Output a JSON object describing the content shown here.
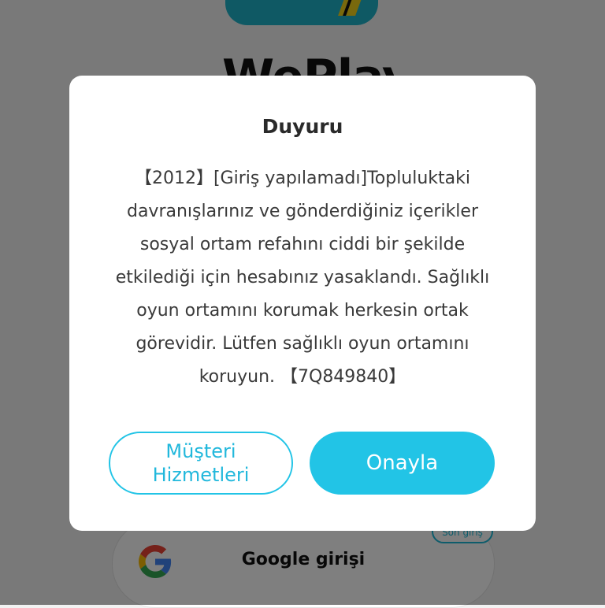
{
  "background": {
    "app_name": "WePlay",
    "google_login_label": "Google girişi",
    "last_login_badge": "Son giriş"
  },
  "dialog": {
    "title": "Duyuru",
    "message_lines": [
      "【2012】[Giriş yapılamadı]Topluluktaki",
      "davranışlarınız ve gönderdiğiniz içerikler",
      "sosyal ortam refahını ciddi bir şekilde",
      "etkilediği için hesabınız yasaklandı. Sağlıklı",
      "oyun ortamını korumak herkesin ortak",
      "görevidir. Lütfen sağlıklı oyun ortamını",
      "koruyun. 【7Q849840】"
    ],
    "support_button": {
      "line1": "Müşteri",
      "line2": "Hizmetleri"
    },
    "confirm_button": "Onayla"
  },
  "colors": {
    "accent": "#22c4e6",
    "scrim": "rgba(0,0,0,0.5)",
    "dialog_bg": "#ffffff"
  },
  "icons": {
    "google": "google-icon"
  }
}
